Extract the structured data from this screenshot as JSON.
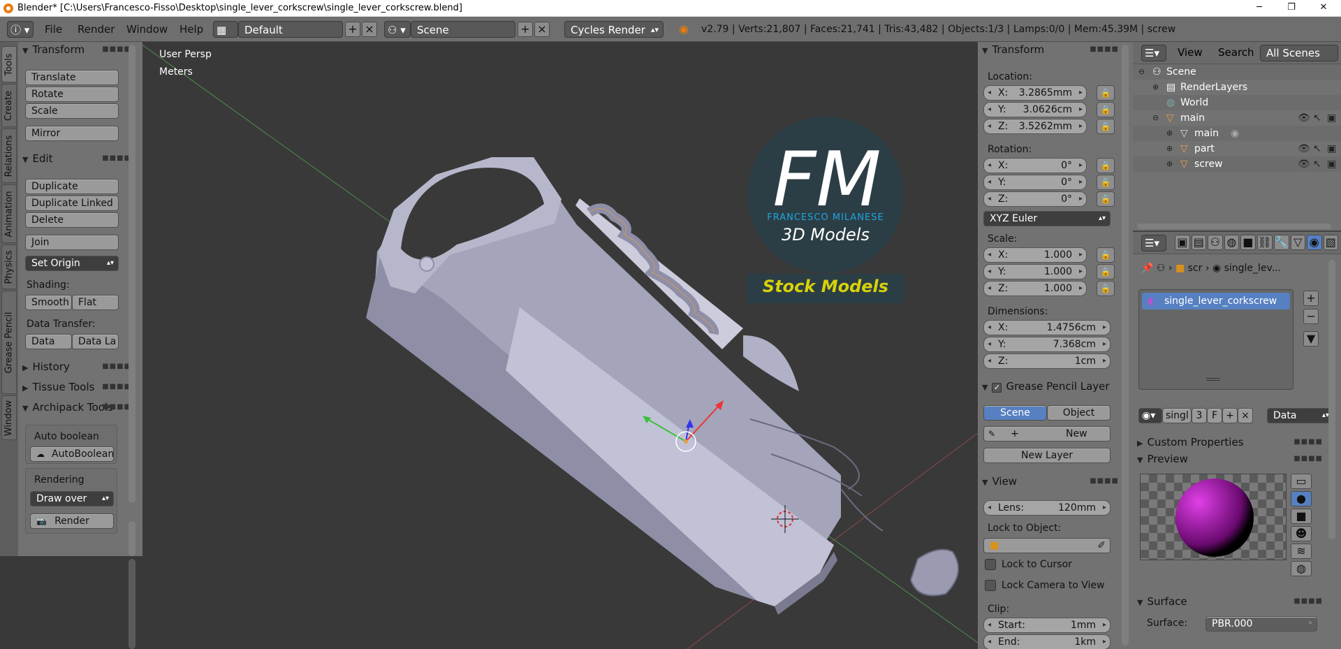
{
  "title_bar": {
    "text": "Blender* [C:\\Users\\Francesco-Fisso\\Desktop\\single_lever_corkscrew\\single_lever_corkscrew.blend]",
    "minimize": "─",
    "maximize": "❐",
    "close": "✕"
  },
  "info_header": {
    "menus": [
      "File",
      "Render",
      "Window",
      "Help"
    ],
    "screen_layout": "Default",
    "scene": "Scene",
    "render_engine": "Cycles Render",
    "stats": "v2.79 | Verts:21,807 | Faces:21,741 | Tris:43,482 | Objects:1/3 | Lamps:0/0 | Mem:45.39M | screw"
  },
  "side_tabs": [
    "Tools",
    "Create",
    "Relations",
    "Animation",
    "Physics",
    "Grease Pencil",
    "Window"
  ],
  "tool_shelf": {
    "transform_header": "Transform",
    "translate": "Translate",
    "rotate": "Rotate",
    "scale": "Scale",
    "mirror": "Mirror",
    "edit_header": "Edit",
    "duplicate": "Duplicate",
    "duplicate_linked": "Duplicate Linked",
    "delete": "Delete",
    "join": "Join",
    "set_origin": "Set Origin",
    "shading_label": "Shading:",
    "smooth": "Smooth",
    "flat": "Flat",
    "data_transfer_label": "Data Transfer:",
    "data": "Data",
    "data_la": "Data La",
    "history": "History",
    "tissue_tools": "Tissue Tools",
    "archipack_tools": "Archipack Tools",
    "auto_boolean_label": "Auto boolean",
    "autoboolean_btn": "AutoBoolean",
    "rendering_label": "Rendering",
    "draw_over": "Draw over",
    "render_btn": "Render"
  },
  "viewport": {
    "view_name": "User Persp",
    "units": "Meters",
    "logo_letters": "FM",
    "logo_name": "FRANCESCO MILANESE",
    "logo_sub": "3D Models",
    "stock_models": "Stock Models"
  },
  "properties_panel": {
    "transform_header": "Transform",
    "location_label": "Location:",
    "location": {
      "x": "3.2865mm",
      "y": "3.0626cm",
      "z": "3.5262mm"
    },
    "rotation_label": "Rotation:",
    "rotation": {
      "x": "0°",
      "y": "0°",
      "z": "0°"
    },
    "rotation_mode": "XYZ Euler",
    "scale_label": "Scale:",
    "scale": {
      "x": "1.000",
      "y": "1.000",
      "z": "1.000"
    },
    "dimensions_label": "Dimensions:",
    "dimensions": {
      "x": "1.4756cm",
      "y": "7.368cm",
      "z": "1cm"
    },
    "grease_pencil_header": "Grease Pencil Layer",
    "scene_btn": "Scene",
    "object_btn": "Object",
    "new_btn": "New",
    "new_layer_btn": "New Layer",
    "view_header": "View",
    "lens_label": "Lens:",
    "lens_value": "120mm",
    "lock_to_object_label": "Lock to Object:",
    "lock_to_cursor": "Lock to Cursor",
    "lock_camera_to_view": "Lock Camera to View",
    "clip_label": "Clip:",
    "clip_start_label": "Start:",
    "clip_start": "1mm",
    "clip_end_label": "End:",
    "clip_end": "1km",
    "axis_x": "X:",
    "axis_y": "Y:",
    "axis_z": "Z:"
  },
  "outliner": {
    "view": "View",
    "search": "Search",
    "filter": "All Scenes",
    "items": [
      {
        "label": "Scene"
      },
      {
        "label": "RenderLayers"
      },
      {
        "label": "World"
      },
      {
        "label": "main"
      },
      {
        "label": "main"
      },
      {
        "label": "part"
      },
      {
        "label": "screw"
      }
    ]
  },
  "material_editor": {
    "crumb_obj": "scr",
    "crumb_mat": "single_lev...",
    "material_slot": "single_lever_corkscrew",
    "mat_name_field": "singl",
    "users": "3",
    "fake": "F",
    "link": "Data",
    "custom_properties": "Custom Properties",
    "preview": "Preview",
    "surface_header": "Surface",
    "surface_label": "Surface:",
    "surface_value": "PBR.000"
  }
}
